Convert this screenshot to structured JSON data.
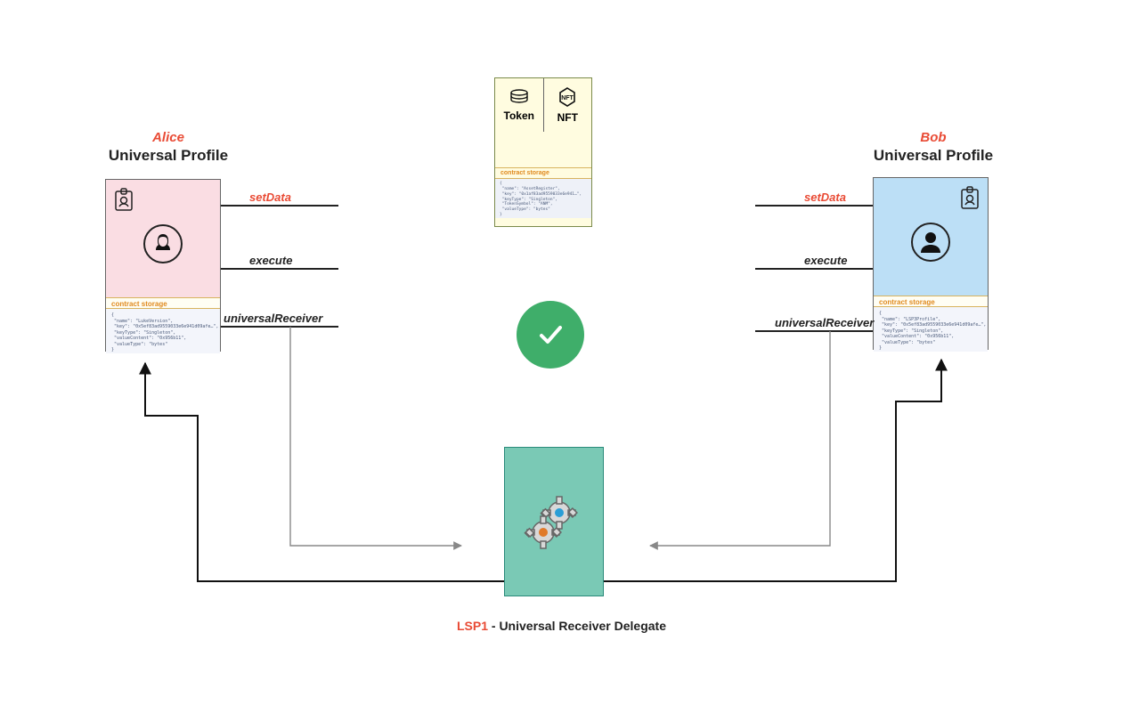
{
  "alice": {
    "name": "Alice",
    "subtitle": "Universal Profile",
    "storage_label": "contract storage",
    "storage_text": "{\n \"name\": \"LukeVersion\",\n \"key\": \"0x5ef83ad9559033e6e941d09afe…\",\n \"keyType\": \"Singleton\",\n \"valueContent\": \"0x956b11\",\n \"valueType\": \"bytes\"\n}",
    "functions": {
      "setData": "setData",
      "execute": "execute",
      "universalReceiver": "universalReceiver"
    }
  },
  "bob": {
    "name": "Bob",
    "subtitle": "Universal Profile",
    "storage_label": "contract storage",
    "storage_text": "{\n \"name\": \"LSP3Profile\",\n \"key\": \"0x5ef83ad9559033e6e941d09afe…\",\n \"keyType\": \"Singleton\",\n \"valueContent\": \"0x956b11\",\n \"valueType\": \"bytes\"\n}",
    "functions": {
      "setData": "setData",
      "execute": "execute",
      "universalReceiver": "universalReceiver"
    }
  },
  "token_card": {
    "token_label": "Token",
    "nft_label": "NFT",
    "storage_label": "contract storage",
    "storage_text": "{\n \"name\": \"AssetRegister\",\n \"key\": \"0x1af83ad9559033e6e941…\",\n \"keyType\": \"Singleton\",\n \"TokenSymbol\": \"ANM\",\n \"valueType\": \"bytes\"\n}"
  },
  "caption": {
    "lsp": "LSP1",
    "rest": " - Universal Receiver Delegate"
  },
  "icons": {
    "alice_avatar": "female-avatar",
    "bob_avatar": "male-avatar",
    "id_badge": "id-badge-icon",
    "coins": "coins-icon",
    "nft_hex": "nft-hex-icon",
    "check": "check-icon",
    "gears": "gears-icon"
  },
  "colors": {
    "red": "#e94b35",
    "green": "#3fae6a",
    "teal": "#7ac9b5",
    "alice_bg": "#fadde3",
    "bob_bg": "#bcdff6"
  }
}
